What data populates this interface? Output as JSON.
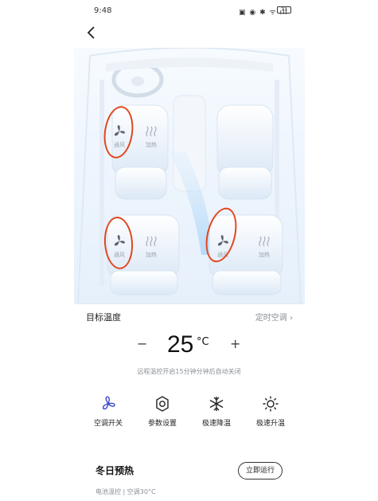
{
  "status": {
    "time": "9:48",
    "icons": "▣ ◉ ✱ ᯤ ıll",
    "battery": "73"
  },
  "seats": {
    "front_left": {
      "fan_label": "通风",
      "heat_label": "加热"
    },
    "rear_left": {
      "fan_label": "通风",
      "heat_label": "加热"
    },
    "rear_right": {
      "fan_label": "通风",
      "heat_label": "加热"
    }
  },
  "target": {
    "label": "目标温度",
    "timer_link": "定时空调 ›"
  },
  "temp": {
    "minus": "−",
    "value": "25",
    "unit": "°C",
    "plus": "+"
  },
  "hint": "远程温控开启15分钟分钟后自动关闭",
  "actions": [
    {
      "label": "空调开关",
      "icon": "fan-icon"
    },
    {
      "label": "参数设置",
      "icon": "settings-icon"
    },
    {
      "label": "极速降温",
      "icon": "snowflake-icon"
    },
    {
      "label": "极速升温",
      "icon": "sun-icon"
    }
  ],
  "winter": {
    "title": "冬日预热",
    "button": "立即运行",
    "subtitle": "电池温控 | 空调30°C"
  },
  "colors": {
    "accent": "#3a49c9",
    "annotation": "#e2461f"
  }
}
